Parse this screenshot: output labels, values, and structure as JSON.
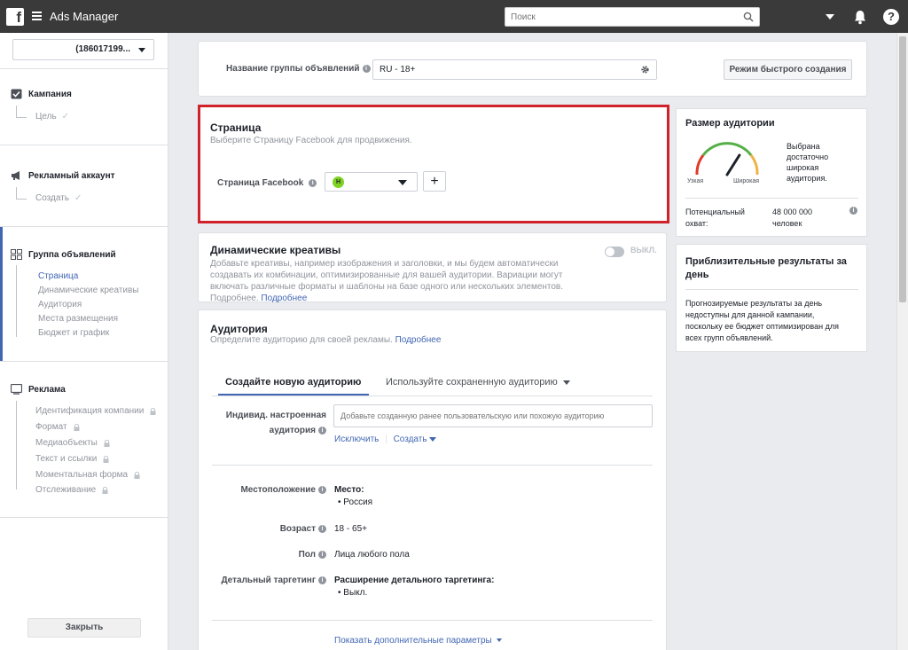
{
  "topbar": {
    "app_title": "Ads Manager",
    "search_placeholder": "Поиск"
  },
  "sidebar": {
    "account": "(186017199...",
    "campaign": {
      "label": "Кампания",
      "sub": "Цель"
    },
    "ad_account": {
      "label": "Рекламный аккаунт",
      "sub": "Создать"
    },
    "ad_set": {
      "label": "Группа объявлений",
      "items": [
        "Страница",
        "Динамические креативы",
        "Аудитория",
        "Места размещения",
        "Бюджет и график"
      ]
    },
    "ad": {
      "label": "Реклама",
      "items": [
        "Идентификация компании",
        "Формат",
        "Медиаобъекты",
        "Текст и ссылки",
        "Моментальная форма",
        "Отслеживание"
      ]
    },
    "close_label": "Закрыть"
  },
  "adset_name": {
    "label": "Название группы объявлений",
    "value": "RU - 18+",
    "quick_create_label": "Режим быстрого создания"
  },
  "page_section": {
    "title": "Страница",
    "subtitle": "Выберите Страницу Facebook для продвижения.",
    "field_label": "Страница Facebook",
    "avatar_letter": "Н",
    "add_label": "+"
  },
  "dynamic": {
    "title": "Динамические креативы",
    "desc": "Добавьте креативы, например изображения и заголовки, и мы будем автоматически создавать их комбинации, оптимизированные для вашей аудитории. Вариации могут включать различные форматы и шаблоны на базе одного или нескольких элементов. Подробнее.",
    "more_link": "Подробнее",
    "toggle_label": "ВЫКЛ."
  },
  "audience": {
    "title": "Аудитория",
    "subtitle": "Определите аудиторию для своей рекламы.",
    "subtitle_link": "Подробнее",
    "tab_new": "Создайте новую аудиторию",
    "tab_saved": "Используйте сохраненную аудиторию",
    "custom_label_1": "Индивид. настроенная",
    "custom_label_2": "аудитория",
    "custom_placeholder": "Добавьте созданную ранее пользовательскую или похожую аудиторию",
    "exclude_link": "Исключить",
    "create_link": "Создать",
    "location_label": "Местоположение",
    "location_title": "Место:",
    "location_value": "Россия",
    "age_label": "Возраст",
    "age_value": "18 - 65+",
    "gender_label": "Пол",
    "gender_value": "Лица любого пола",
    "detailed_label": "Детальный таргетинг",
    "detailed_title": "Расширение детального таргетинга:",
    "detailed_value": "Выкл.",
    "more_params": "Показать дополнительные параметры"
  },
  "audience_size": {
    "title": "Размер аудитории",
    "gauge_low": "Узкая",
    "gauge_high": "Широкая",
    "gauge_level": 0.68,
    "verdict_lines": [
      "Выбрана",
      "достаточно",
      "широкая",
      "аудитория."
    ],
    "reach_label_1": "Потенциальный",
    "reach_label_2": "охват:",
    "reach_value": "48 000 000",
    "reach_unit": "человек"
  },
  "estimates": {
    "title_1": "Приблизительные результаты за",
    "title_2": "день",
    "lines": [
      "Прогнозируемые результаты за день",
      "недоступны для данной кампании,",
      "поскольку ее бюджет оптимизирован для",
      "всех групп объявлений."
    ]
  },
  "colors": {
    "topbar": "#3a3a3a",
    "accent": "#4267b2",
    "highlight_border": "#d0222a",
    "avatar_bg": "#7ed321"
  }
}
